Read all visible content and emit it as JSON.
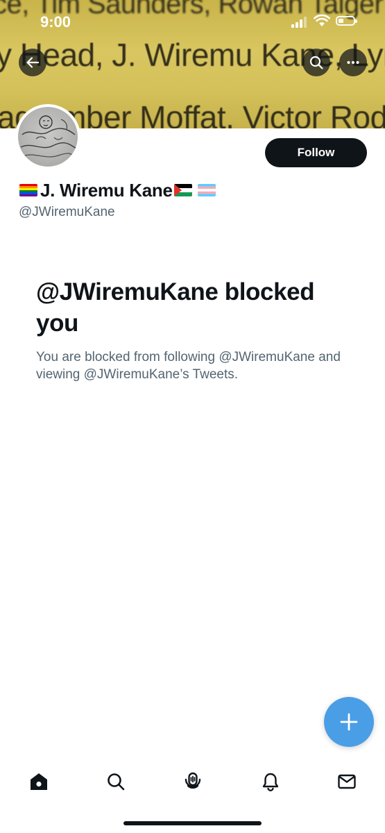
{
  "status_bar": {
    "time": "9:00"
  },
  "banner": {
    "lines": [
      "ce, Tim Saunders, Rowan Talger",
      "y Head, J. Wiremu Kane, Lyndse",
      "ag Amber Moffat, Victor Rodo"
    ]
  },
  "profile": {
    "display_name": "J. Wiremu Kane",
    "handle": "@JWiremuKane",
    "name_flags": [
      "rainbow-flag-icon",
      "palestine-flag-icon",
      "transgender-flag-icon"
    ]
  },
  "actions": {
    "follow_label": "Follow"
  },
  "blocked": {
    "title": "@JWiremuKane blocked you",
    "subtitle": "You are blocked from following @JWiremuKane and viewing @JWiremuKane’s Tweets."
  },
  "icons": {
    "back": "arrow-left-icon",
    "search": "search-icon",
    "more": "more-horizontal-icon",
    "fab": "plus-icon",
    "nav": [
      "home-icon",
      "search-icon",
      "spaces-icon",
      "bell-icon",
      "mail-icon"
    ]
  },
  "colors": {
    "accent": "#4a9ee6",
    "text_primary": "#0f1419",
    "text_secondary": "#536471",
    "banner": "#d4c15a"
  }
}
